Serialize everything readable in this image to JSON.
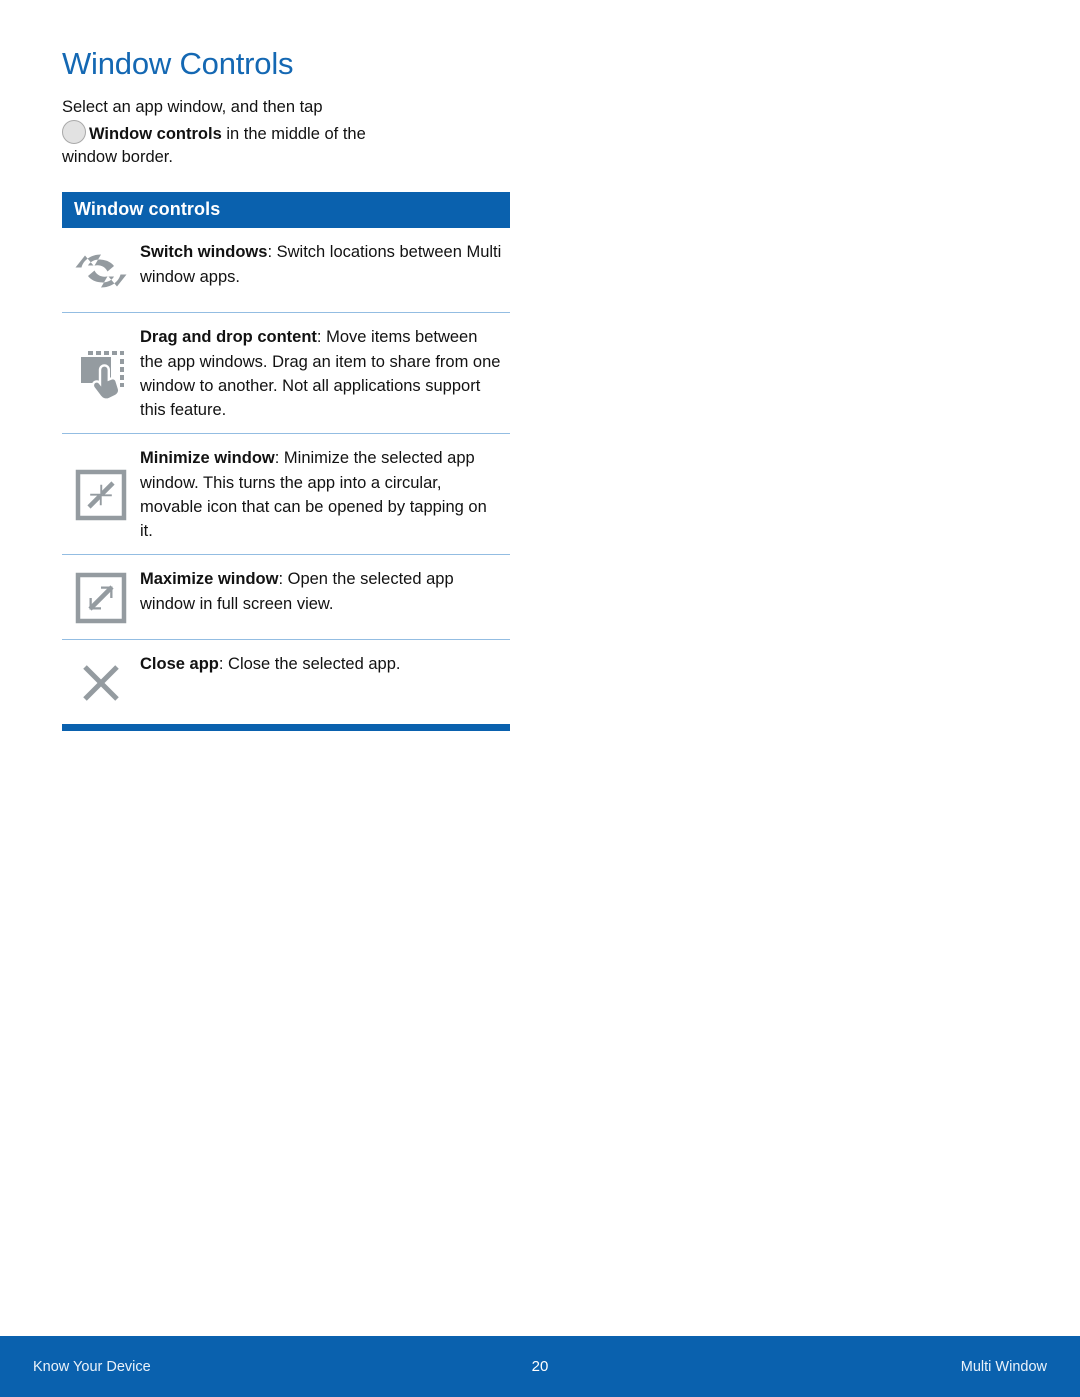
{
  "page": {
    "title": "Window Controls",
    "intro": {
      "line1": "Select an app window, and then tap",
      "icon": "circle-icon",
      "bold_term": "Window controls",
      "line2_rest": " in the middle of the",
      "line3": "window border."
    }
  },
  "controls_table": {
    "header": "Window controls",
    "rows": [
      {
        "icon": "switch-windows-icon",
        "term": "Switch windows",
        "separator": ": ",
        "description": "Switch locations between Multi window apps."
      },
      {
        "icon": "drag-and-drop-icon",
        "term": "Drag and drop content",
        "separator": ": ",
        "description": "Move items between the app windows. Drag an item to share from one window to another. Not all applications support this feature."
      },
      {
        "icon": "minimize-window-icon",
        "term": "Minimize window",
        "separator": ": ",
        "description": "Minimize the selected app window. This turns the app into a circular, movable icon that can be opened by tapping on it."
      },
      {
        "icon": "maximize-window-icon",
        "term": "Maximize window",
        "separator": ": ",
        "description": "Open the selected app window in full screen view."
      },
      {
        "icon": "close-app-icon",
        "term": "Close app",
        "separator": ": ",
        "description": "Close the selected app."
      }
    ]
  },
  "footer": {
    "left": "Know Your Device",
    "page_number": "20",
    "right": "Multi Window"
  },
  "colors": {
    "title_blue": "#1468b3",
    "header_blue": "#0a61ae",
    "divider_blue": "#93bde2",
    "icon_gray": "#949ba0",
    "footer_blue": "#0a61ae",
    "text_black": "#121212"
  }
}
